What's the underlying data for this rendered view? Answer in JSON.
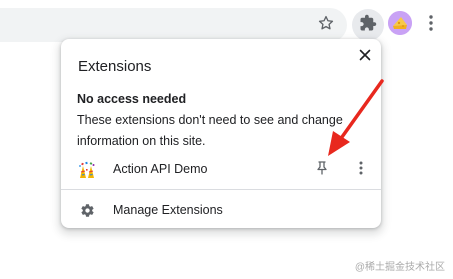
{
  "popup": {
    "title": "Extensions",
    "section_heading": "No access needed",
    "section_description": "These extensions don't need to see and change information on this site.",
    "extensions": [
      {
        "name": "Action API Demo",
        "icon": "confetti-icon"
      }
    ],
    "manage_label": "Manage Extensions"
  },
  "toolbar": {
    "icons": [
      "star-icon",
      "puzzle-icon",
      "avatar",
      "more-vert-icon"
    ]
  },
  "watermark": "@稀土掘金技术社区",
  "colors": {
    "arrow": "#e8281e",
    "text": "#202124",
    "icon": "#5f6368",
    "omnibox": "#f1f3f4",
    "extension_button_bg": "#e8eaed",
    "avatar_bg": "#c9a2f5"
  }
}
